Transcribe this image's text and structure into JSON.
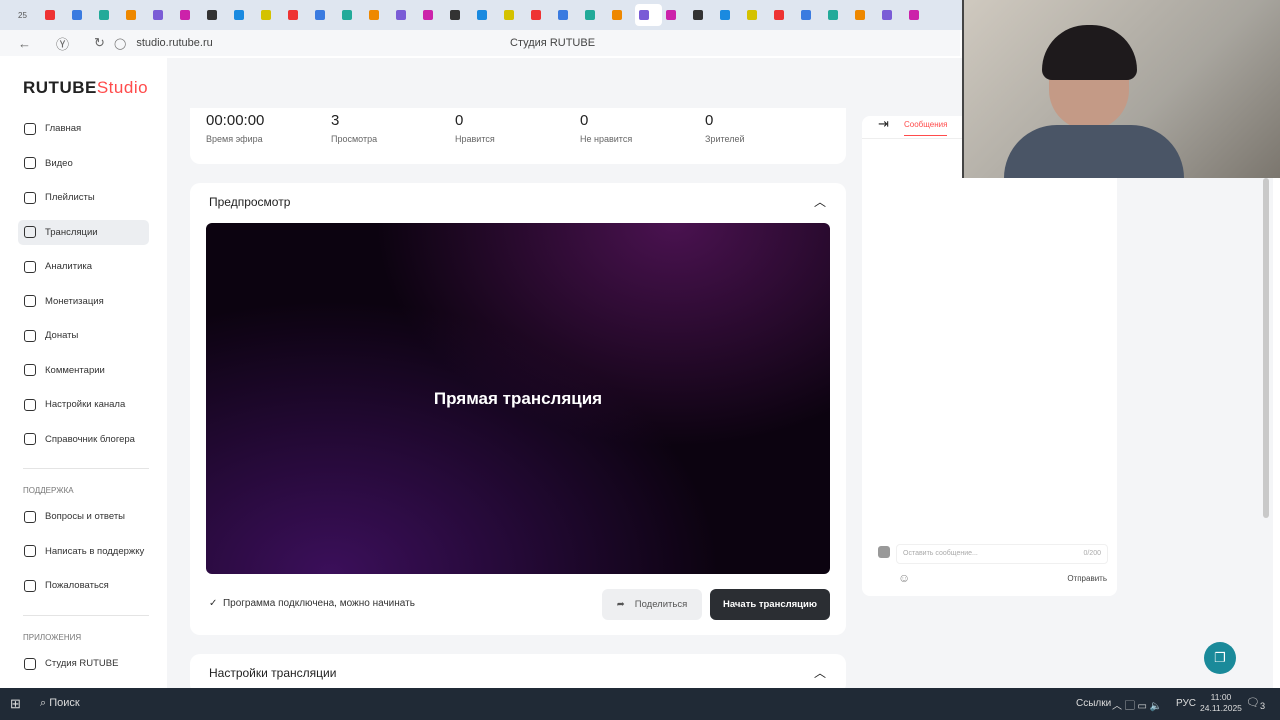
{
  "browser": {
    "tab_count": "25",
    "url": "studio.rutube.ru",
    "title": "Студия RUTUBE"
  },
  "logo": {
    "brand": "RUTUBE",
    "product": "Studio",
    "accent": "#ff4b4b"
  },
  "sidebar": {
    "items": [
      {
        "label": "Главная"
      },
      {
        "label": "Видео"
      },
      {
        "label": "Плейлисты"
      },
      {
        "label": "Трансляции",
        "active": true
      },
      {
        "label": "Аналитика"
      },
      {
        "label": "Монетизация"
      },
      {
        "label": "Донаты"
      },
      {
        "label": "Комментарии"
      },
      {
        "label": "Настройки канала"
      },
      {
        "label": "Справочник блогера"
      }
    ],
    "support_title": "ПОДДЕРЖКА",
    "support": [
      {
        "label": "Вопросы и ответы"
      },
      {
        "label": "Написать в поддержку"
      },
      {
        "label": "Пожаловаться"
      }
    ],
    "apps_title": "ПРИЛОЖЕНИЯ",
    "apps": [
      {
        "label": "Студия RUTUBE"
      }
    ]
  },
  "stats": [
    {
      "value": "00:00:00",
      "label": "Время эфира"
    },
    {
      "value": "3",
      "label": "Просмотра"
    },
    {
      "value": "0",
      "label": "Нравится"
    },
    {
      "value": "0",
      "label": "Не нравится"
    },
    {
      "value": "0",
      "label": "Зрителей"
    }
  ],
  "preview": {
    "title": "Предпросмотр",
    "overlay": "Прямая трансляция",
    "status": "Программа подключена, можно начинать",
    "share": "Поделиться",
    "start": "Начать трансляцию"
  },
  "settings": {
    "title": "Настройки трансляции"
  },
  "chat": {
    "tab": "Сообщения",
    "placeholder": "Оставить сообщение...",
    "counter": "0/200",
    "send": "Отправить"
  },
  "taskbar": {
    "search": "Поиск",
    "links": "Ссылки",
    "lang": "РУС",
    "time": "11:00",
    "date": "24.11.2025",
    "notifications": "3"
  }
}
